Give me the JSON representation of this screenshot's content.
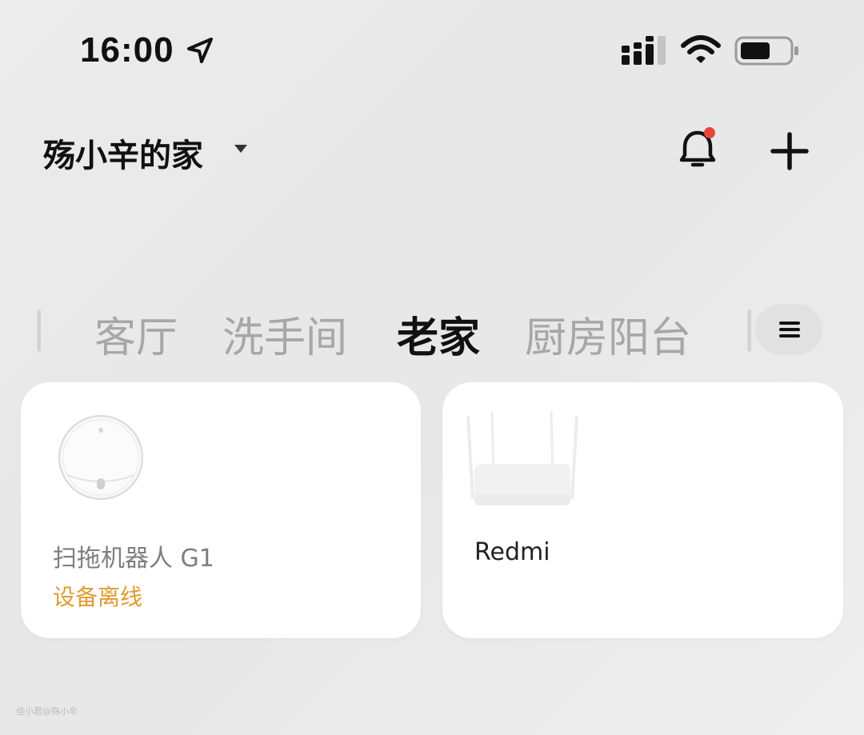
{
  "status_bar": {
    "time": "16:00",
    "icons": [
      "location-arrow-icon",
      "cellular-signal-icon",
      "wifi-icon",
      "battery-icon"
    ]
  },
  "header": {
    "home_name": "殇小辛的家",
    "icons": [
      "dropdown-caret-icon",
      "bell-icon",
      "plus-icon"
    ],
    "notification_dot_color": "#e8453c"
  },
  "tabs": {
    "items": [
      {
        "label": "客厅",
        "active": false
      },
      {
        "label": "洗手间",
        "active": false
      },
      {
        "label": "老家",
        "active": true
      },
      {
        "label": "厨房阳台",
        "active": false
      }
    ],
    "menu_icon": "hamburger-menu-icon"
  },
  "devices": [
    {
      "name": "扫拖机器人 G1",
      "status": "设备离线",
      "status_color": "#e39a30",
      "icon": "robot-vacuum-icon"
    },
    {
      "name": "Redmi",
      "status": "",
      "icon": "router-icon"
    }
  ],
  "watermark": "佳小君@殇小辛"
}
